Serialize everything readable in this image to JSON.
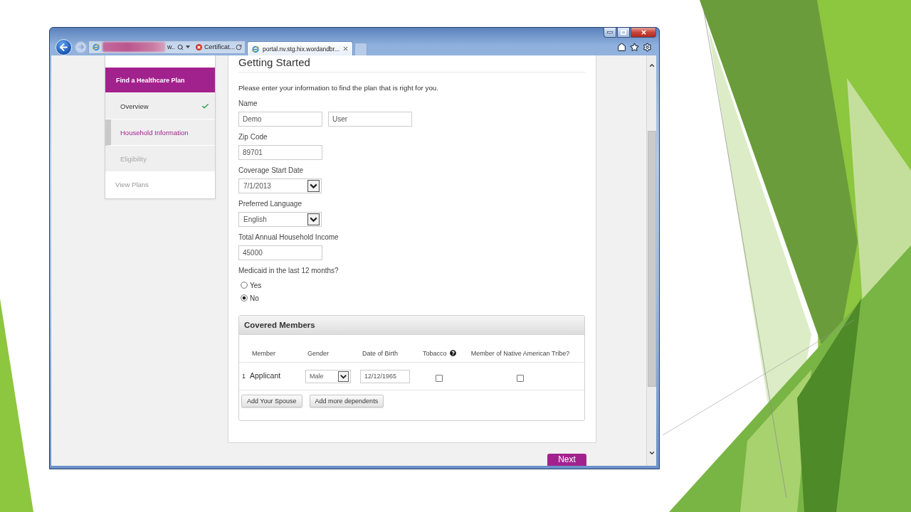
{
  "browser": {
    "forward_disabled": true,
    "address_bar": {
      "text": "w..",
      "security_label": "Certificat..."
    },
    "tabs": [
      {
        "label": "portal.nv.stg.hix.wordandbr...",
        "selected": true
      }
    ]
  },
  "sidebar": {
    "items": [
      {
        "kind": "header",
        "label": "Find a Healthcare Plan",
        "selected": true
      },
      {
        "kind": "step",
        "label": "Overview",
        "selected": false,
        "completed": true,
        "disabled": false
      },
      {
        "kind": "step",
        "label": "Household Information",
        "selected": true,
        "completed": false,
        "disabled": false
      },
      {
        "kind": "step",
        "label": "Eligibility",
        "selected": false,
        "completed": false,
        "disabled": true
      },
      {
        "kind": "link",
        "label": "View Plans",
        "selected": false
      }
    ]
  },
  "form": {
    "title": "Getting Started",
    "intro": "Please enter your information to find the plan that is right for you.",
    "fields": [
      {
        "kind": "text",
        "label": "Name",
        "values": [
          "Demo",
          "User"
        ]
      },
      {
        "kind": "text",
        "label": "Zip Code",
        "values": [
          "89701"
        ]
      },
      {
        "kind": "select",
        "label": "Coverage Start Date",
        "value": "7/1/2013"
      },
      {
        "kind": "select",
        "label": "Preferred Language",
        "value": "English"
      },
      {
        "kind": "text",
        "label": "Total Annual Household Income",
        "values": [
          "45000"
        ]
      },
      {
        "kind": "radio",
        "label": "Medicaid in the last 12 months?",
        "options": [
          {
            "label": "Yes",
            "selected": false
          },
          {
            "label": "No",
            "selected": true
          }
        ]
      }
    ]
  },
  "covered_members": {
    "title": "Covered Members",
    "columns": [
      {
        "label": "Member"
      },
      {
        "label": "Gender"
      },
      {
        "label": "Date of Birth"
      },
      {
        "label": "Tobacco",
        "help": true
      },
      {
        "label": "Member of Native American Tribe?"
      }
    ],
    "rows": [
      {
        "number": "1",
        "member": "Applicant",
        "gender": "Male",
        "date_of_birth": "12/12/1965",
        "tobacco": {
          "checked": false
        },
        "native_american_tribe": {
          "checked": false
        }
      }
    ],
    "buttons": [
      "Add Your Spouse",
      "Add more dependents"
    ]
  },
  "next_button": {
    "label": "Next"
  }
}
